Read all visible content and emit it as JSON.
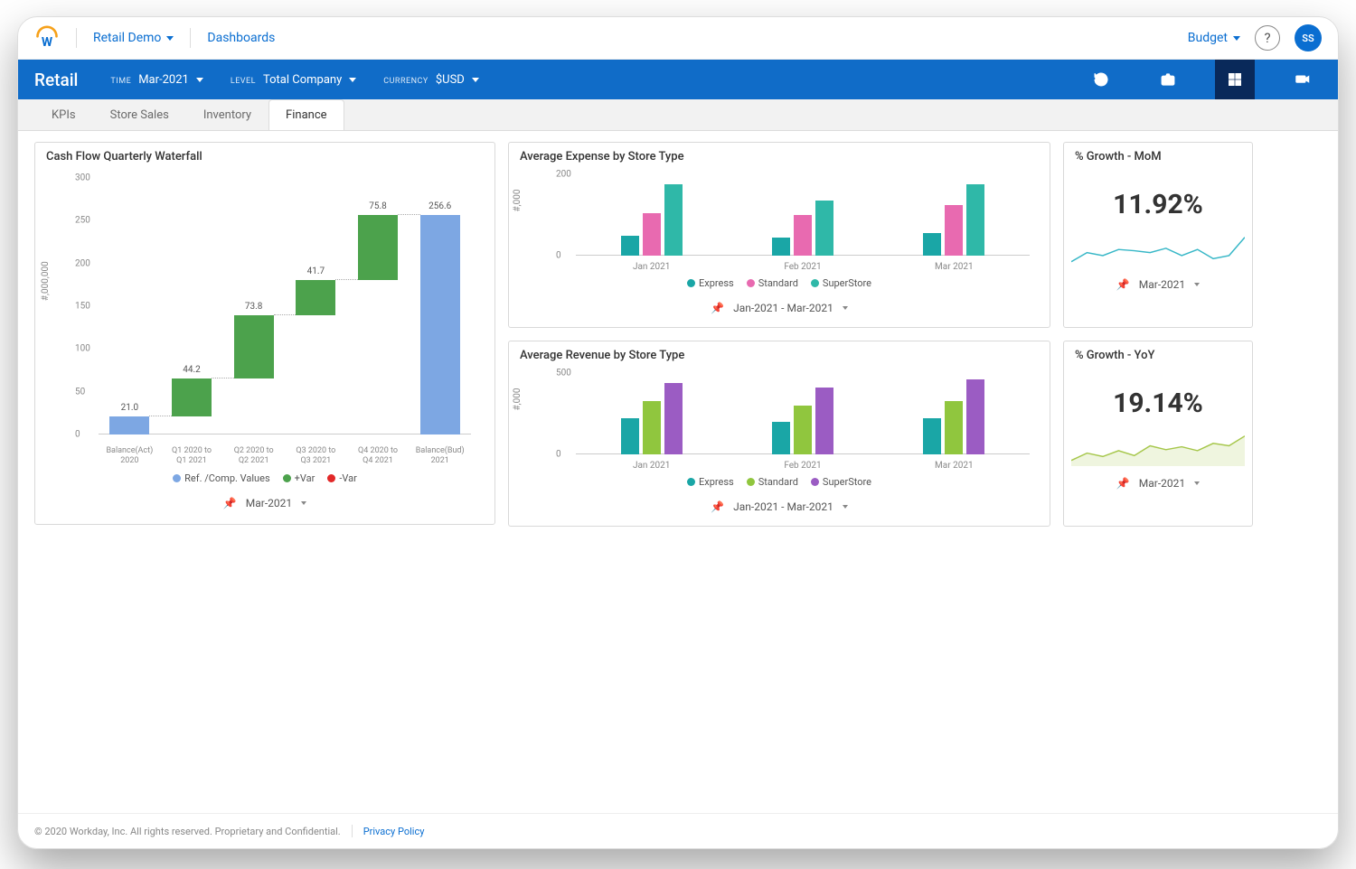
{
  "header": {
    "workspace": "Retail Demo",
    "nav_link": "Dashboards",
    "right_link": "Budget",
    "avatar_initials": "SS"
  },
  "filters": {
    "page_title": "Retail",
    "time_label": "TIME",
    "time_value": "Mar-2021",
    "level_label": "LEVEL",
    "level_value": "Total Company",
    "currency_label": "CURRENCY",
    "currency_value": "$USD"
  },
  "tabs": [
    "KPIs",
    "Store Sales",
    "Inventory",
    "Finance"
  ],
  "active_tab": "Finance",
  "panels": {
    "waterfall_title": "Cash Flow Quarterly Waterfall",
    "waterfall_footer": "Mar-2021",
    "expense_title": "Average Expense by Store Type",
    "expense_footer": "Jan-2021 - Mar-2021",
    "revenue_title": "Average Revenue by Store Type",
    "revenue_footer": "Jan-2021 - Mar-2021",
    "mom_title": "% Growth - MoM",
    "mom_value": "11.92%",
    "mom_footer": "Mar-2021",
    "yoy_title": "% Growth - YoY",
    "yoy_value": "19.14%",
    "yoy_footer": "Mar-2021"
  },
  "legends": {
    "waterfall": [
      "Ref. /Comp. Values",
      "+Var",
      "-Var"
    ],
    "store_type": [
      "Express",
      "Standard",
      "SuperStore"
    ]
  },
  "chart_data": [
    {
      "id": "waterfall",
      "type": "waterfall",
      "title": "Cash Flow Quarterly Waterfall",
      "ylabel": "#,000,000",
      "ylim": [
        0,
        300
      ],
      "yticks": [
        0,
        50,
        100,
        150,
        200,
        250,
        300
      ],
      "bars": [
        {
          "label": "Balance(Act) 2020",
          "kind": "ref",
          "base": 0,
          "value": 21.0,
          "color": "#7da7e3"
        },
        {
          "label": "Q1 2020 to Q1 2021",
          "kind": "pos",
          "base": 21.0,
          "value": 44.2,
          "color": "#4ca24c"
        },
        {
          "label": "Q2 2020 to Q2 2021",
          "kind": "pos",
          "base": 65.2,
          "value": 73.8,
          "color": "#4ca24c"
        },
        {
          "label": "Q3 2020 to Q3 2021",
          "kind": "pos",
          "base": 139.0,
          "value": 41.7,
          "color": "#4ca24c"
        },
        {
          "label": "Q4 2020 to Q4 2021",
          "kind": "pos",
          "base": 180.7,
          "value": 75.8,
          "color": "#4ca24c"
        },
        {
          "label": "Balance(Bud) 2021",
          "kind": "ref",
          "base": 0,
          "value": 256.6,
          "color": "#7da7e3"
        }
      ]
    },
    {
      "id": "expense",
      "type": "bar",
      "title": "Average Expense by Store Type",
      "ylabel": "#,000",
      "ylim": [
        0,
        200
      ],
      "yticks": [
        0,
        200
      ],
      "categories": [
        "Jan 2021",
        "Feb 2021",
        "Mar 2021"
      ],
      "series": [
        {
          "name": "Express",
          "color": "#1aa6a6",
          "values": [
            50,
            45,
            55
          ]
        },
        {
          "name": "Standard",
          "color": "#e86ab0",
          "values": [
            105,
            100,
            125
          ]
        },
        {
          "name": "SuperStore",
          "color": "#2fb8a8",
          "values": [
            175,
            135,
            175
          ]
        }
      ]
    },
    {
      "id": "revenue",
      "type": "bar",
      "title": "Average Revenue by Store Type",
      "ylabel": "#,000",
      "ylim": [
        0,
        500
      ],
      "yticks": [
        0,
        500
      ],
      "categories": [
        "Jan 2021",
        "Feb 2021",
        "Mar 2021"
      ],
      "series": [
        {
          "name": "Express",
          "color": "#1aa6a6",
          "values": [
            220,
            200,
            225
          ]
        },
        {
          "name": "Standard",
          "color": "#90c63e",
          "values": [
            330,
            300,
            330
          ]
        },
        {
          "name": "SuperStore",
          "color": "#9b5cc3",
          "values": [
            440,
            410,
            460
          ]
        }
      ]
    },
    {
      "id": "mom_spark",
      "type": "line",
      "color": "#37b7c7",
      "values": [
        10,
        11.5,
        11,
        12,
        11.8,
        11.5,
        12.2,
        11,
        12,
        10.5,
        11,
        14
      ]
    },
    {
      "id": "yoy_spark",
      "type": "area",
      "color": "#a6c74b",
      "values": [
        16,
        17.5,
        16.8,
        18,
        17,
        19,
        18.2,
        18.8,
        18,
        19.5,
        19,
        21
      ]
    }
  ],
  "footer": {
    "copyright": "© 2020 Workday, Inc. All rights reserved. Proprietary and Confidential.",
    "privacy": "Privacy Policy"
  }
}
